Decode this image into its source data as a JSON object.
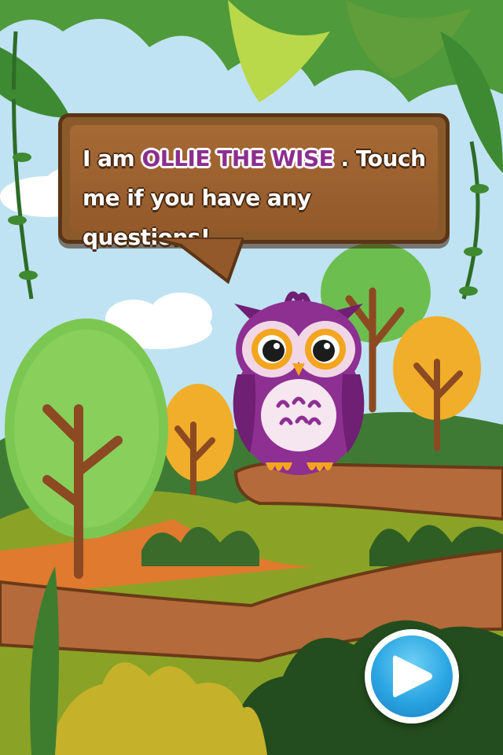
{
  "screen": "owl-intro",
  "speech": {
    "before": "I am ",
    "name": "OLLIE THE WISE",
    "after": " . Touch me if you have any questions!"
  },
  "character": {
    "icon": "owl-icon",
    "color": "#8e2f92"
  },
  "controls": {
    "play": {
      "icon": "play-icon",
      "color": "#2aa5e2"
    }
  },
  "colors": {
    "sign": "#93592a",
    "name_text": "#8b2f8f",
    "sky": "#bfe3f2"
  }
}
